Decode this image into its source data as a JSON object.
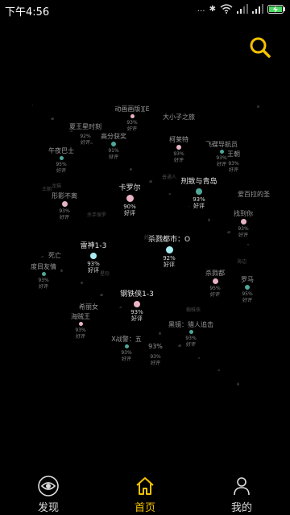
{
  "status": {
    "time": "下午4:56",
    "indicators": "... ✱ 4G",
    "icons": [
      "dots-icon",
      "bluetooth-icon",
      "wifi-icon",
      "signal-icon",
      "signal-icon",
      "battery-charging-icon"
    ]
  },
  "colors": {
    "accent": "#f2c200",
    "background": "#000000",
    "dot_teal": "#4fa89a",
    "dot_pink": "#e8b4c4",
    "dot_cyan": "#a8ecf2"
  },
  "nodes": [
    {
      "title": "动画画版][E",
      "pct": "93%",
      "sub": "好评",
      "dot": "pink",
      "size": 5,
      "big": false
    },
    {
      "title": "大小子之旅",
      "pct": "",
      "sub": "",
      "dot": "none",
      "size": 0,
      "big": false
    },
    {
      "title": "夏王星时刻",
      "pct": "92%",
      "sub": "好评",
      "dot": "none",
      "size": 0,
      "big": false
    },
    {
      "title": "高分获奖",
      "pct": "91%",
      "sub": "好评",
      "dot": "teal",
      "size": 6,
      "big": false
    },
    {
      "title": "柯莱特",
      "pct": "93%",
      "sub": "好评",
      "dot": "pink",
      "size": 6,
      "big": false
    },
    {
      "title": "飞碟导航员",
      "pct": "93%",
      "sub": "好评",
      "dot": "teal",
      "size": 5,
      "big": false
    },
    {
      "title": "午夜巴士",
      "pct": "95%",
      "sub": "好评",
      "dot": "teal",
      "size": 5,
      "big": false
    },
    {
      "title": "王朝",
      "pct": "93%",
      "sub": "好评",
      "dot": "none",
      "size": 0,
      "big": false
    },
    {
      "title": "卡罗尔",
      "pct": "90%",
      "sub": "好评",
      "dot": "pink",
      "size": 9,
      "big": true
    },
    {
      "title": "刑致与青岛",
      "pct": "93%",
      "sub": "好评",
      "dot": "teal",
      "size": 8,
      "big": true
    },
    {
      "title": "形影不离",
      "pct": "93%",
      "sub": "好评",
      "dot": "pink",
      "size": 7,
      "big": false
    },
    {
      "title": "爱百拉的圣",
      "pct": "",
      "sub": "",
      "dot": "none",
      "size": 0,
      "big": false
    },
    {
      "title": "找到你",
      "pct": "93%",
      "sub": "好评",
      "dot": "pink",
      "size": 7,
      "big": false
    },
    {
      "title": "杀戮都市：O",
      "pct": "92%",
      "sub": "好评",
      "dot": "cyan",
      "size": 9,
      "big": true
    },
    {
      "title": "雷神1-3",
      "pct": "93%",
      "sub": "好评",
      "dot": "cyan",
      "size": 8,
      "big": true
    },
    {
      "title": "死亡",
      "pct": "",
      "sub": "",
      "dot": "none",
      "size": 0,
      "big": false
    },
    {
      "title": "度目友情",
      "pct": "93%",
      "sub": "好评",
      "dot": "teal",
      "size": 5,
      "big": false
    },
    {
      "title": "杀戮都",
      "pct": "95%",
      "sub": "好评",
      "dot": "pink",
      "size": 7,
      "big": false
    },
    {
      "title": "罗马",
      "pct": "95%",
      "sub": "好评",
      "dot": "teal",
      "size": 6,
      "big": false
    },
    {
      "title": "钢铁侠1-3",
      "pct": "93%",
      "sub": "好评",
      "dot": "pink",
      "size": 8,
      "big": true
    },
    {
      "title": "希丽女",
      "pct": "",
      "sub": "",
      "dot": "none",
      "size": 0,
      "big": false
    },
    {
      "title": "海贼王",
      "pct": "93%",
      "sub": "好评",
      "dot": "pink",
      "size": 5,
      "big": false
    },
    {
      "title": "X战警：五",
      "pct": "93%",
      "sub": "好评",
      "dot": "teal",
      "size": 5,
      "big": false
    },
    {
      "title": "黑镜：猎人追击",
      "pct": "93%",
      "sub": "好评",
      "dot": "teal",
      "size": 5,
      "big": false
    },
    {
      "title": "93%",
      "pct": "93%",
      "sub": "好评",
      "dot": "none",
      "size": 0,
      "big": false
    }
  ],
  "faint_labels": [
    "王朝",
    "龙猫",
    "杀手保罗",
    "普通人",
    "星际",
    "蜘蛛侠",
    "海边",
    "好评"
  ],
  "nav": {
    "items": [
      {
        "label": "发现",
        "icon": "eye-icon"
      },
      {
        "label": "首页",
        "icon": "home-icon"
      },
      {
        "label": "我的",
        "icon": "person-icon"
      }
    ]
  }
}
